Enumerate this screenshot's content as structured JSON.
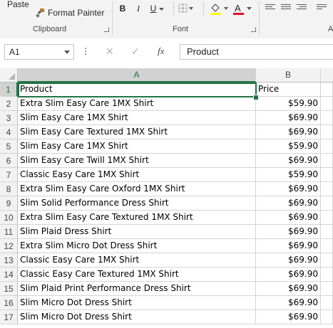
{
  "ribbon": {
    "paste_label": "Paste",
    "format_painter_label": "Format Painter",
    "clipboard_label": "Clipboard",
    "font_label": "Font",
    "bold": "B",
    "italic": "I",
    "underline": "U",
    "font_color_letter": "A",
    "alignment_partial_label": "A"
  },
  "formula_bar": {
    "name_box": "A1",
    "fx": "fx",
    "cancel": "✕",
    "enter": "✓",
    "content": "Product"
  },
  "columns": [
    "A",
    "B"
  ],
  "rows": [
    {
      "num": "1",
      "product": "Product",
      "price": "Price"
    },
    {
      "num": "2",
      "product": "Extra Slim Easy Care 1MX Shirt",
      "price": "$59.90"
    },
    {
      "num": "3",
      "product": "Slim Easy Care 1MX Shirt",
      "price": "$69.90"
    },
    {
      "num": "4",
      "product": "Slim Easy Care Textured 1MX Shirt",
      "price": "$69.90"
    },
    {
      "num": "5",
      "product": "Slim Easy Care 1MX Shirt",
      "price": "$59.90"
    },
    {
      "num": "6",
      "product": "Slim Easy Care Twill 1MX Shirt",
      "price": "$69.90"
    },
    {
      "num": "7",
      "product": "Classic Easy Care 1MX Shirt",
      "price": "$59.90"
    },
    {
      "num": "8",
      "product": "Extra Slim Easy Care Oxford 1MX Shirt",
      "price": "$69.90"
    },
    {
      "num": "9",
      "product": "Slim Solid Performance Dress Shirt",
      "price": "$69.90"
    },
    {
      "num": "10",
      "product": "Extra Slim Easy Care Textured 1MX Shirt",
      "price": "$69.90"
    },
    {
      "num": "11",
      "product": "Slim Plaid Dress Shirt",
      "price": "$69.90"
    },
    {
      "num": "12",
      "product": "Extra Slim Micro Dot Dress Shirt",
      "price": "$69.90"
    },
    {
      "num": "13",
      "product": "Classic Easy Care 1MX Shirt",
      "price": "$69.90"
    },
    {
      "num": "14",
      "product": "Classic Easy Care Textured 1MX Shirt",
      "price": "$69.90"
    },
    {
      "num": "15",
      "product": "Slim Plaid Print Performance Dress Shirt",
      "price": "$69.90"
    },
    {
      "num": "16",
      "product": "Slim Micro Dot Dress Shirt",
      "price": "$69.90"
    },
    {
      "num": "17",
      "product": "Slim Micro Dot Dress Shirt",
      "price": "$69.90"
    }
  ],
  "colors": {
    "accent": "#217346",
    "font_color_bar": "#e81123",
    "highlight_bar": "#ffff00"
  }
}
